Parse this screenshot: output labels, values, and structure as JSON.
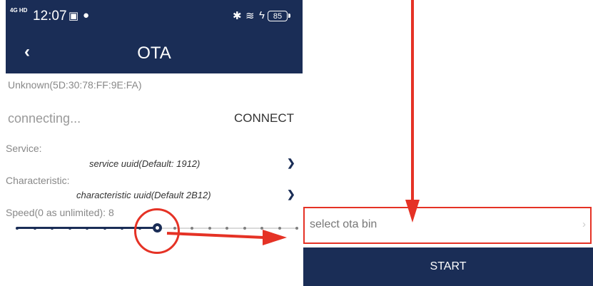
{
  "status_bar": {
    "signal": "4G HD",
    "time": "12:07",
    "battery": "85"
  },
  "nav": {
    "title": "OTA"
  },
  "device": {
    "name": "Unknown(5D:30:78:FF:9E:FA)"
  },
  "connection": {
    "status": "connecting...",
    "connect_label": "CONNECT"
  },
  "service": {
    "label": "Service:",
    "value": "service uuid(Default: 1912)"
  },
  "characteristic": {
    "label": "Characteristic:",
    "value": "characteristic uuid(Default 2B12)"
  },
  "speed": {
    "label": "Speed(0 as unlimited): 8",
    "value": 8,
    "steps": 16
  },
  "file": {
    "placeholder": "select ota bin"
  },
  "actions": {
    "start_label": "START"
  },
  "colors": {
    "primary": "#1a2d56",
    "annotation": "#e53225"
  }
}
